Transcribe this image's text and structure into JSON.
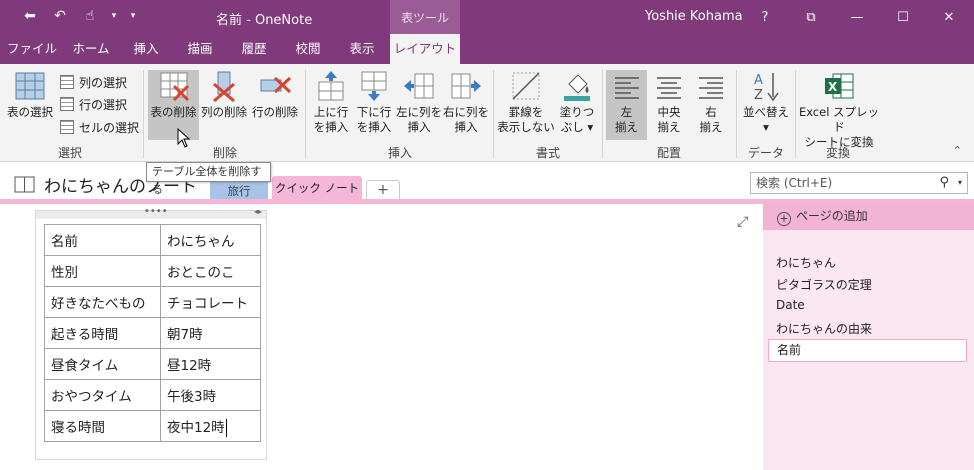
{
  "window": {
    "title": "名前 - OneNote",
    "context_tab": "表ツール",
    "user": "Yoshie Kohama",
    "help": "?",
    "restore_ribbon": "⧉",
    "minimize": "—",
    "maximize": "☐",
    "close": "✕"
  },
  "qat": {
    "back": "⬅",
    "undo": "↶",
    "touch": "☝",
    "touch_drop": "▾",
    "customize": "▾"
  },
  "tabs": [
    "ファイル",
    "ホーム",
    "挿入",
    "描画",
    "履歴",
    "校閲",
    "表示",
    "レイアウト"
  ],
  "ribbon": {
    "select_group": "選択",
    "select_table": "表の選択",
    "select_column": "列の選択",
    "select_row": "行の選択",
    "select_cell": "セルの選択",
    "delete_group": "削除",
    "delete_table": "表の削除",
    "delete_column": "列の削除",
    "delete_row": "行の削除",
    "insert_group": "挿入",
    "insert_above_1": "上に行",
    "insert_above_2": "を挿入",
    "insert_below_1": "下に行",
    "insert_below_2": "を挿入",
    "insert_left_1": "左に列を",
    "insert_left_2": "挿入",
    "insert_right_1": "右に列を",
    "insert_right_2": "挿入",
    "format_group": "書式",
    "hide_borders_1": "罫線を",
    "hide_borders_2": "表示しない",
    "shading_1": "塗りつ",
    "shading_2": "ぶし ▾",
    "align_group": "配置",
    "align_left_1": "左",
    "align_left_2": "揃え",
    "align_center_1": "中央",
    "align_center_2": "揃え",
    "align_right_1": "右",
    "align_right_2": "揃え",
    "data_group": "データ",
    "sort_1": "並べ替え",
    "sort_2": "▾",
    "convert_group": "変換",
    "excel_1": "Excel スプレッド",
    "excel_2": "シートに変換",
    "collapse": "⌃"
  },
  "tooltip": "テーブル全体を削除する",
  "notebook": {
    "title": "わにちゃんのノート",
    "sections": [
      "旅行",
      "クイック ノート"
    ],
    "add_section": "+",
    "search_placeholder": "検索 (Ctrl+E)",
    "search_icon": "⚲",
    "search_drop": "▾"
  },
  "canvas": {
    "expand": "⤢",
    "handle_dots": "••••",
    "handle_arrows": "◂▸"
  },
  "table": [
    [
      "名前",
      "わにちゃん"
    ],
    [
      "性別",
      "おとこのこ"
    ],
    [
      "好きなたべもの",
      "チョコレート"
    ],
    [
      "起きる時間",
      "朝7時"
    ],
    [
      "昼食タイム",
      "昼12時"
    ],
    [
      "おやつタイム",
      "午後3時"
    ],
    [
      "寝る時間",
      "夜中12時"
    ]
  ],
  "pages": {
    "add_page": "ページの追加",
    "add_plus": "+",
    "items": [
      "わにちゃん",
      "ピタゴラスの定理",
      "Date",
      "わにちゃんの由来",
      "名前"
    ]
  }
}
